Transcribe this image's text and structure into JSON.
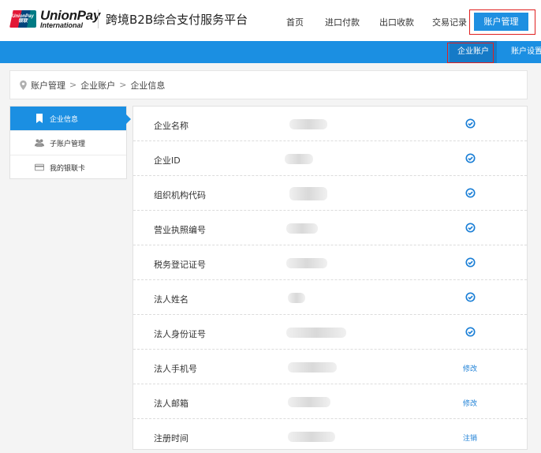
{
  "header": {
    "logo": {
      "main": "UnionPay",
      "sub": "International",
      "badge": "UnionPay 银联"
    },
    "platform_title": "跨境B2B综合支付服务平台",
    "nav": [
      "首页",
      "进口付款",
      "出口收款",
      "交易记录"
    ],
    "nav_active": "账户管理"
  },
  "subnav": {
    "active": "企业账户",
    "other": "账户设置"
  },
  "breadcrumb": [
    "账户管理",
    "企业账户",
    "企业信息"
  ],
  "breadcrumb_sep": ">",
  "sidebar": {
    "items": [
      {
        "label": "企业信息",
        "icon": "bookmark-icon",
        "active": true
      },
      {
        "label": "子账户管理",
        "icon": "users-icon",
        "active": false
      },
      {
        "label": "我的银联卡",
        "icon": "card-icon",
        "active": false
      }
    ]
  },
  "info_rows": [
    {
      "label": "企业名称",
      "action": "check-circle-icon"
    },
    {
      "label": "企业ID",
      "action": "check-circle-icon"
    },
    {
      "label": "组织机构代码",
      "action": "check-circle-icon"
    },
    {
      "label": "营业执照编号",
      "action": "check-circle-icon"
    },
    {
      "label": "税务登记证号",
      "action": "check-circle-icon"
    },
    {
      "label": "法人姓名",
      "action": "check-circle-icon"
    },
    {
      "label": "法人身份证号",
      "action": "check-circle-icon"
    },
    {
      "label": "法人手机号",
      "link": "修改"
    },
    {
      "label": "法人邮箱",
      "link": "修改"
    },
    {
      "label": "注册时间",
      "link": "注销"
    }
  ],
  "colors": {
    "primary": "#1b8fe2",
    "highlight_box": "#e02020",
    "link": "#1b7fd6"
  }
}
